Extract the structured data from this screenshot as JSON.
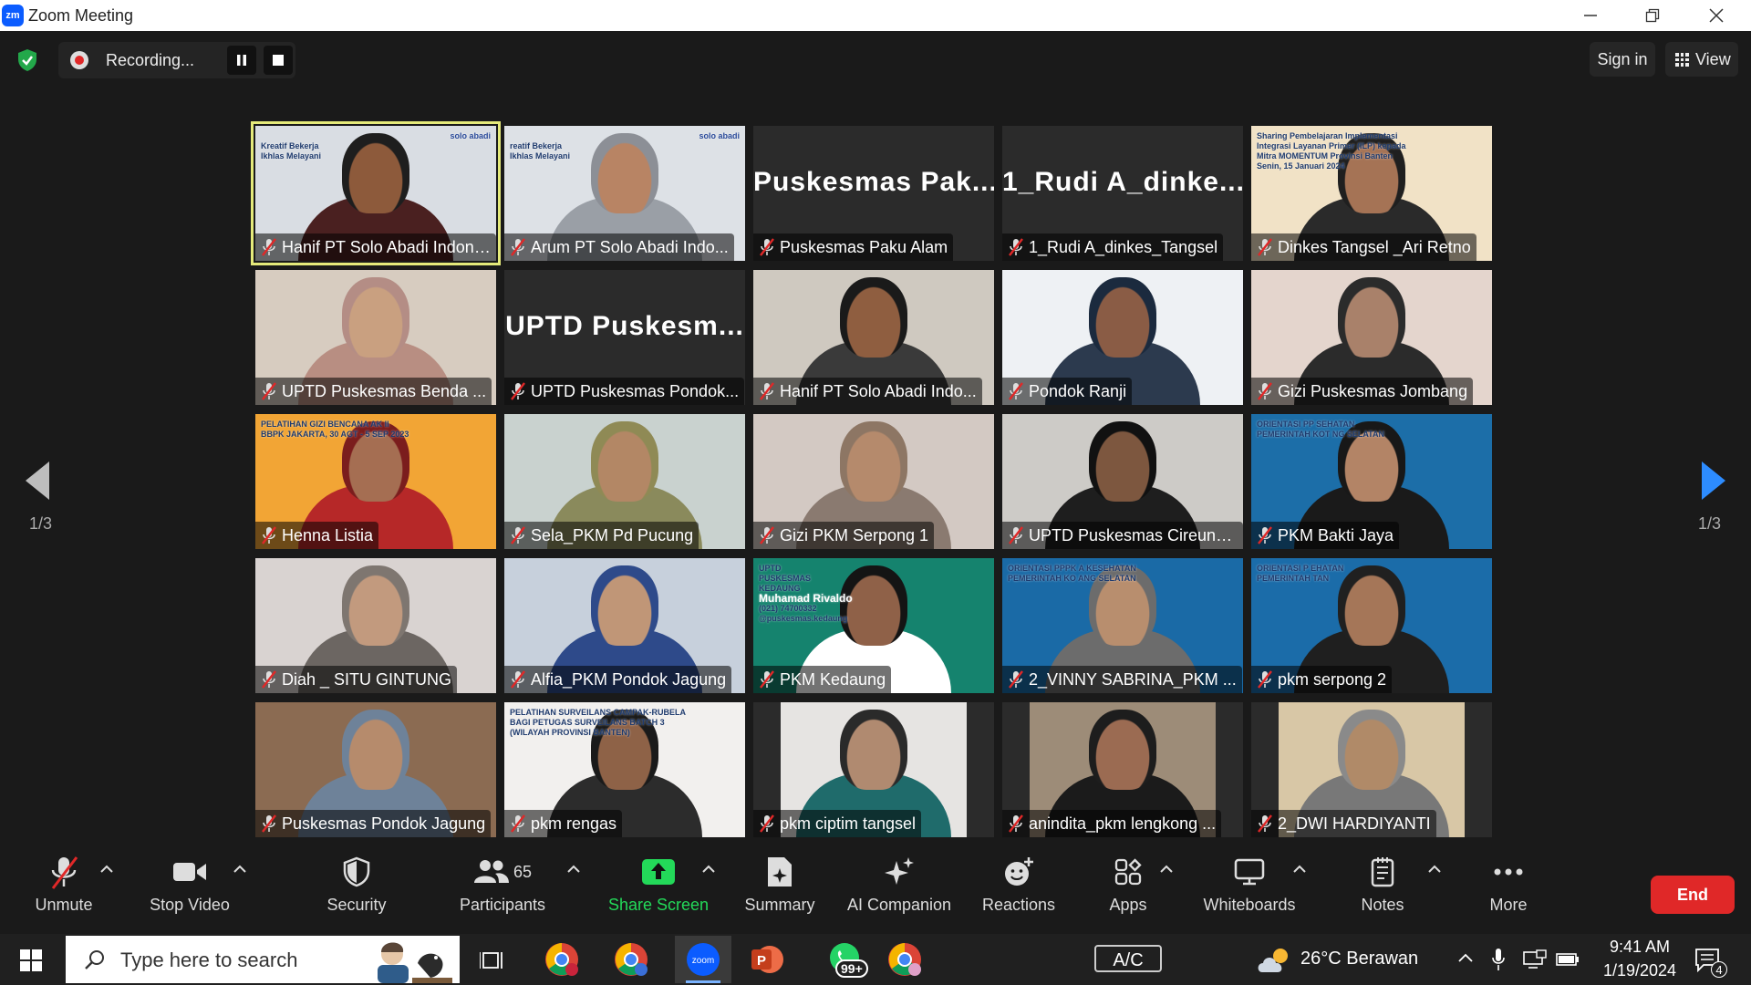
{
  "window": {
    "logo": "zm",
    "title": "Zoom Meeting"
  },
  "topbar": {
    "recording_label": "Recording...",
    "sign_in": "Sign in",
    "view": "View"
  },
  "pagination": {
    "left": "1/3",
    "right": "1/3"
  },
  "tiles": [
    {
      "name": "Hanif PT Solo Abadi Indonesia",
      "video": true,
      "active": true,
      "bg": "#d9dde3",
      "skin": "#8d5a3b",
      "shirt": "#4a2020",
      "head": "#1e1e1e",
      "slide": {
        "brand": "solo abadi",
        "line1": "Kreatif Bekerja",
        "line2": "Ikhlas Melayani"
      }
    },
    {
      "name": "Arum PT Solo Abadi Indo...",
      "video": true,
      "bg": "#dde1e6",
      "skin": "#b88464",
      "shirt": "#9a9fa6",
      "head": "#8c8f96",
      "slide": {
        "brand": "solo abadi",
        "line1": "reatif Bekerja",
        "line2": "Ikhlas Melayani"
      }
    },
    {
      "name": "Puskesmas Paku Alam",
      "video": false,
      "bigname": "Puskesmas Pak..."
    },
    {
      "name": "1_Rudi A_dinkes_Tangsel",
      "video": false,
      "bigname": "1_Rudi A_dinke..."
    },
    {
      "name": "Dinkes Tangsel _Ari Retno",
      "video": true,
      "bg": "#f1e2c6",
      "skin": "#a57355",
      "shirt": "#2a2a2a",
      "head": "#1f1f1f",
      "slide": {
        "line1": "Sharing Pembelajaran Implementasi",
        "line2": "Integrasi Layanan Primer (ILP) kepada",
        "line3": "Mitra MOMENTUM Provinsi Banten",
        "date": "Senin, 15 Januari 2024"
      }
    },
    {
      "name": "UPTD Puskesmas Benda ...",
      "video": true,
      "bg": "#d7ccc0",
      "skin": "#c9a080",
      "shirt": "#b88e82",
      "head": "#b48d85"
    },
    {
      "name": "UPTD Puskesmas Pondok...",
      "video": false,
      "bigname": "UPTD Puskesm..."
    },
    {
      "name": "Hanif PT Solo Abadi Indo...",
      "video": true,
      "bg": "#cfc9c0",
      "skin": "#8f5e40",
      "shirt": "#3a3a3a",
      "head": "#1a1a1a"
    },
    {
      "name": "Pondok Ranji",
      "video": true,
      "bg": "#eef1f4",
      "skin": "#8a5c45",
      "shirt": "#2c3a4e",
      "head": "#1b2a3e"
    },
    {
      "name": "Gizi Puskesmas Jombang",
      "video": true,
      "bg": "#e4d5cd",
      "skin": "#a9816a",
      "shirt": "#2b2b2b",
      "head": "#2b2b2b"
    },
    {
      "name": "Henna Listia",
      "video": true,
      "bg": "#f2a535",
      "skin": "#a56e52",
      "shirt": "#b62828",
      "head": "#7b1d1d",
      "slide": {
        "line1": "PELATIHAN GIZI BENCANA AK II",
        "line2": "BBPK JAKARTA, 30 AGT - 5 SEP 2023"
      }
    },
    {
      "name": "Sela_PKM Pd Pucung",
      "video": true,
      "bg": "#c9d2cf",
      "skin": "#b38765",
      "shirt": "#8a8a5c",
      "head": "#8f8a55"
    },
    {
      "name": "Gizi PKM Serpong 1",
      "video": true,
      "bg": "#d3c9c3",
      "skin": "#b58a6c",
      "shirt": "#8a7a70",
      "head": "#8d7664"
    },
    {
      "name": "UPTD Puskesmas Cireund...",
      "video": true,
      "bg": "#cdcbc7",
      "skin": "#7d573f",
      "shirt": "#1e1e1e",
      "head": "#111111"
    },
    {
      "name": "PKM Bakti Jaya",
      "video": true,
      "bg": "#1c6ea8",
      "skin": "#b38466",
      "shirt": "#1a1a1a",
      "head": "#181818",
      "slide": {
        "line1": "ORIENTASI PP          SEHATAN",
        "line2": "PEMERINTAH KOT       NG SELATAN"
      }
    },
    {
      "name": "Diah _ SITU GINTUNG",
      "video": true,
      "bg": "#d9d3d1",
      "skin": "#c29a7e",
      "shirt": "#6c6662",
      "head": "#7e7670"
    },
    {
      "name": "Alfia_PKM Pondok Jagung",
      "video": true,
      "bg": "#c7d0dc",
      "skin": "#c09677",
      "shirt": "#2e4a8a",
      "head": "#2e4a8a"
    },
    {
      "name": "PKM Kedaung",
      "video": true,
      "bg": "#15836e",
      "skin": "#8f6148",
      "shirt": "#ffffff",
      "head": "#141414",
      "slide": {
        "line1": "UPTD",
        "line2": "PUSKESMAS",
        "line3": "KEDAUNG",
        "person": "Muhamad Rivaldo",
        "contact1": "(021) 74700332",
        "contact2": "@puskesmas.kedaung"
      }
    },
    {
      "name": "2_VINNY SABRINA_PKM ...",
      "video": true,
      "bg": "#1a6aa6",
      "skin": "#b88e6e",
      "shirt": "#6c6c6c",
      "head": "#6c6c6c",
      "slide": {
        "line1": "ORIENTASI PPPK       A KESEHATAN",
        "line2": "PEMERINTAH KO       ANG SELATAN"
      }
    },
    {
      "name": "pkm serpong 2",
      "video": true,
      "bg": "#1b6ca9",
      "skin": "#a57658",
      "shirt": "#1f1f1f",
      "head": "#202020",
      "slide": {
        "line1": "ORIENTASI P          EHATAN",
        "line2": "PEMERINTAH           TAN"
      }
    },
    {
      "name": "Puskesmas Pondok Jagung",
      "video": true,
      "bg": "#8b6b52",
      "skin": "#b68b6c",
      "shirt": "#6e8299",
      "head": "#6e8299"
    },
    {
      "name": "pkm rengas",
      "video": true,
      "bg": "#f2f0ee",
      "skin": "#8e6247",
      "shirt": "#2c2c2c",
      "head": "#1a1a1a",
      "slide": {
        "line1": "PELATIHAN SURVEILANS CAMPAK-RUBELA",
        "line2": "BAGI PETUGAS SURVEILANS BATCH 3",
        "line3": "(WILAYAH PROVINSI BANTEN)"
      }
    },
    {
      "name": "pkm ciptim tangsel",
      "video": true,
      "narrow": true,
      "bg": "#e6e4e2",
      "skin": "#b08a70",
      "shirt": "#1f6b6b",
      "head": "#2a2a2a"
    },
    {
      "name": "anindita_pkm lengkong ...",
      "video": true,
      "narrow": true,
      "bg": "#9d8c78",
      "skin": "#9b6b52",
      "shirt": "#1b1b1b",
      "head": "#1d1d1d"
    },
    {
      "name": "2_DWI HARDIYANTI",
      "video": true,
      "narrow": true,
      "bg": "#d8c7a6",
      "skin": "#b08a68",
      "shirt": "#787878",
      "head": "#8a8a8a"
    }
  ],
  "toolbar": {
    "unmute": "Unmute",
    "stop_video": "Stop Video",
    "security": "Security",
    "participants": "Participants",
    "participants_count": "65",
    "share_screen": "Share Screen",
    "summary": "Summary",
    "ai_companion": "AI Companion",
    "reactions": "Reactions",
    "apps": "Apps",
    "whiteboards": "Whiteboards",
    "notes": "Notes",
    "more": "More",
    "end": "End"
  },
  "taskbar": {
    "search_placeholder": "Type here to search",
    "whatsapp_badge": "99+",
    "ac": "A/C",
    "weather": "26°C  Berawan",
    "time": "9:41 AM",
    "date": "1/19/2024",
    "notif_count": "4"
  },
  "colors": {
    "share_green": "#23d959",
    "end_red": "#e02828",
    "active_border": "#e5ea7a",
    "zoom_blue": "#0b5cff"
  }
}
